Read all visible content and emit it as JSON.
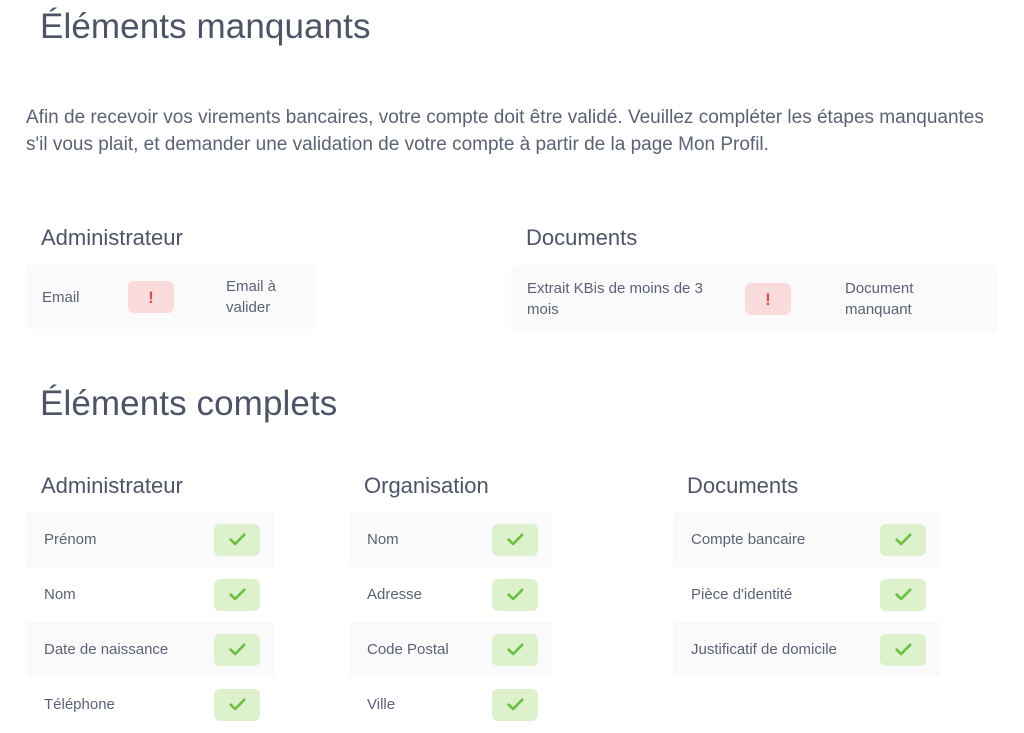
{
  "missing_section": {
    "title": "Éléments manquants",
    "intro": "Afin de recevoir vos virements bancaires, votre compte doit être validé. Veuillez compléter les étapes manquantes s'il vous plait, et demander une validation de votre compte à partir de la page Mon Profil.",
    "groups": [
      {
        "heading": "Administrateur",
        "rows": [
          {
            "label": "Email",
            "badge": "!",
            "status": "Email à valider"
          }
        ]
      },
      {
        "heading": "Documents",
        "rows": [
          {
            "label": "Extrait KBis de moins de 3 mois",
            "badge": "!",
            "status": "Document manquant"
          }
        ]
      }
    ]
  },
  "complete_section": {
    "title": "Éléments complets",
    "groups": [
      {
        "heading": "Administrateur",
        "rows": [
          {
            "label": "Prénom",
            "badge": "check"
          },
          {
            "label": "Nom",
            "badge": "check"
          },
          {
            "label": "Date de naissance",
            "badge": "check"
          },
          {
            "label": "Téléphone",
            "badge": "check"
          }
        ]
      },
      {
        "heading": "Organisation",
        "rows": [
          {
            "label": "Nom",
            "badge": "check"
          },
          {
            "label": "Adresse",
            "badge": "check"
          },
          {
            "label": "Code Postal",
            "badge": "check"
          },
          {
            "label": "Ville",
            "badge": "check"
          }
        ]
      },
      {
        "heading": "Documents",
        "rows": [
          {
            "label": "Compte bancaire",
            "badge": "check"
          },
          {
            "label": "Pièce d'identité",
            "badge": "check"
          },
          {
            "label": "Justificatif de domicile",
            "badge": "check"
          }
        ]
      }
    ]
  },
  "colors": {
    "heading": "#4d5468",
    "body_text": "#5b6275",
    "warn_badge_bg": "#fadcdc",
    "warn_badge_fg": "#e14b4b",
    "ok_badge_bg": "#ddf2cc",
    "ok_badge_fg": "#6bbf3f",
    "row_alt_bg": "#fafafa",
    "page_bg": "#ffffff"
  },
  "icons": {
    "warning": "exclamation-icon",
    "success": "check-icon"
  }
}
